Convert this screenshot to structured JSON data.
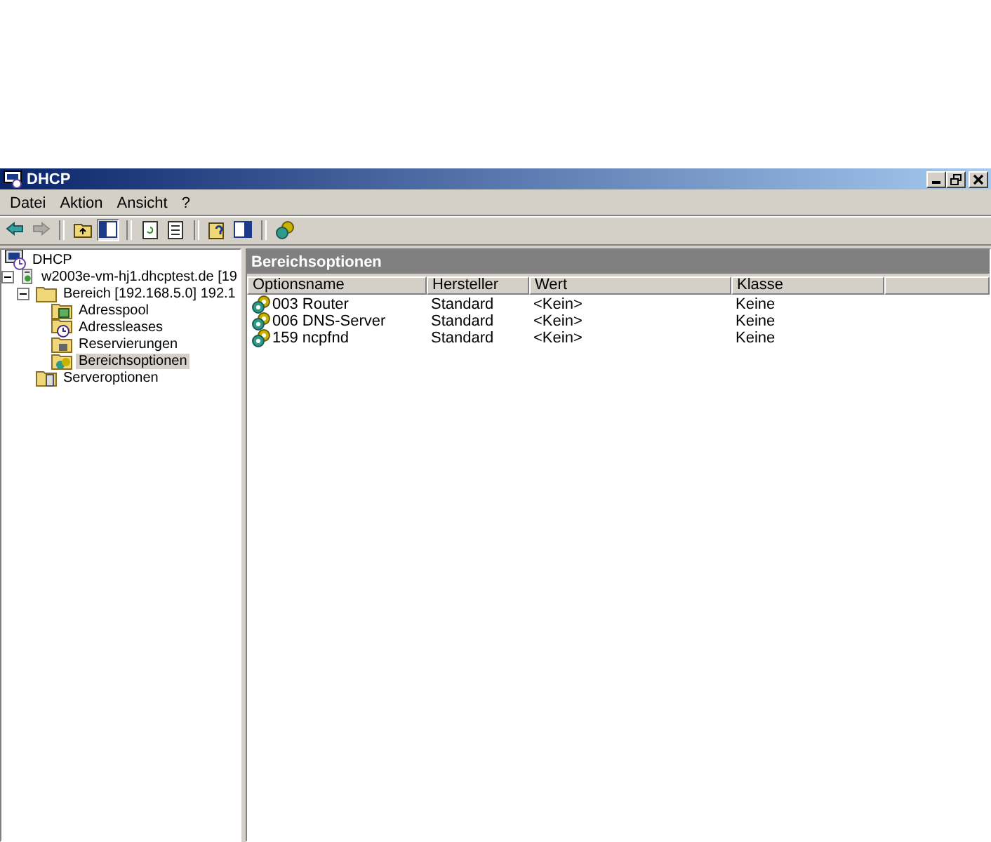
{
  "window": {
    "title": "DHCP"
  },
  "menu": [
    {
      "label": "Datei"
    },
    {
      "label": "Aktion"
    },
    {
      "label": "Ansicht"
    },
    {
      "label": "?"
    }
  ],
  "toolbar": [
    {
      "kind": "back",
      "disabled": false,
      "pressed": false
    },
    {
      "kind": "forward",
      "disabled": true,
      "pressed": false
    },
    {
      "kind": "sep"
    },
    {
      "kind": "up",
      "disabled": false,
      "pressed": false
    },
    {
      "kind": "tree",
      "disabled": false,
      "pressed": true
    },
    {
      "kind": "sep"
    },
    {
      "kind": "refresh",
      "disabled": false,
      "pressed": false
    },
    {
      "kind": "export",
      "disabled": false,
      "pressed": false
    },
    {
      "kind": "sep"
    },
    {
      "kind": "help",
      "disabled": false,
      "pressed": false
    },
    {
      "kind": "panel",
      "disabled": false,
      "pressed": false
    },
    {
      "kind": "sep"
    },
    {
      "kind": "options",
      "disabled": false,
      "pressed": false
    }
  ],
  "tree": [
    {
      "label": "DHCP",
      "kind": "root",
      "selected": false,
      "children": [
        {
          "label": "w2003e-vm-hj1.dhcptest.de [19",
          "kind": "server",
          "selected": false,
          "expanded": true,
          "children": [
            {
              "label": "Bereich [192.168.5.0] 192.1",
              "kind": "folder",
              "selected": false,
              "expanded": true,
              "children": [
                {
                  "label": "Adresspool",
                  "kind": "pool",
                  "selected": false
                },
                {
                  "label": "Adressleases",
                  "kind": "leases",
                  "selected": false
                },
                {
                  "label": "Reservierungen",
                  "kind": "reserv",
                  "selected": false
                },
                {
                  "label": "Bereichsoptionen",
                  "kind": "options",
                  "selected": true
                }
              ]
            },
            {
              "label": "Serveroptionen",
              "kind": "serveropt",
              "selected": false
            }
          ]
        }
      ]
    }
  ],
  "pane": {
    "title": "Bereichsoptionen",
    "columns": [
      "Optionsname",
      "Hersteller",
      "Wert",
      "Klasse"
    ],
    "rows": [
      [
        "003 Router",
        "Standard",
        "<Kein>",
        "Keine"
      ],
      [
        "006 DNS-Server",
        "Standard",
        "<Kein>",
        "Keine"
      ],
      [
        "159 ncpfnd",
        "Standard",
        "<Kein>",
        "Keine"
      ]
    ]
  }
}
